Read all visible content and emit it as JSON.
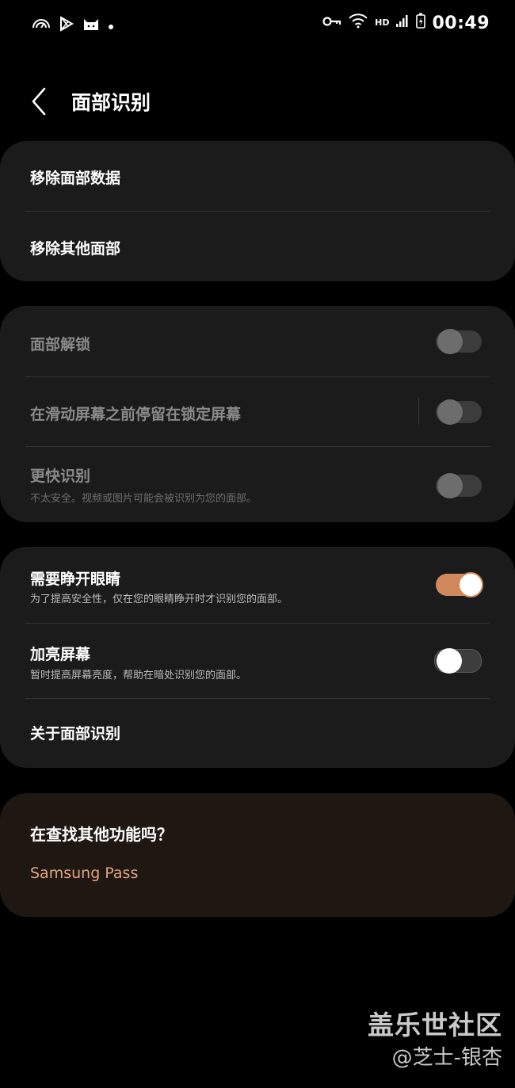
{
  "status_bar": {
    "left_icons": [
      "speedometer-icon",
      "play-store-icon",
      "cat-icon",
      "dot-icon"
    ],
    "right_icons": [
      "key-icon",
      "wifi-icon",
      "hd-icon",
      "signal-icon",
      "battery-icon"
    ],
    "hd_label": "HD",
    "time": "00:49"
  },
  "header": {
    "back_icon": "chevron-left-icon",
    "title": "面部识别"
  },
  "card1": {
    "items": [
      {
        "title": "移除面部数据"
      },
      {
        "title": "移除其他面部"
      }
    ]
  },
  "card2": {
    "items": [
      {
        "title": "面部解锁",
        "toggle": false
      },
      {
        "title": "在滑动屏幕之前停留在锁定屏幕",
        "toggle": false
      },
      {
        "title": "更快识别",
        "subtitle": "不太安全。视频或图片可能会被识别为您的面部。",
        "toggle": false
      }
    ]
  },
  "card3": {
    "items": [
      {
        "title": "需要睁开眼睛",
        "subtitle": "为了提高安全性，仅在您的眼睛睁开时才识别您的面部。",
        "toggle": true
      },
      {
        "title": "加亮屏幕",
        "subtitle": "暂时提高屏幕亮度，帮助在暗处识别您的面部。",
        "toggle": false
      },
      {
        "title": "关于面部识别"
      }
    ]
  },
  "suggestions": {
    "title": "在查找其他功能吗？",
    "link": "Samsung Pass"
  },
  "watermark": {
    "line1": "盖乐世社区",
    "line2": "@芝士-银杏"
  },
  "colors": {
    "accent": "#d0895b",
    "card_bg": "#1b1b1b",
    "suggest_bg": "#1e1712",
    "link": "#e3a480"
  }
}
